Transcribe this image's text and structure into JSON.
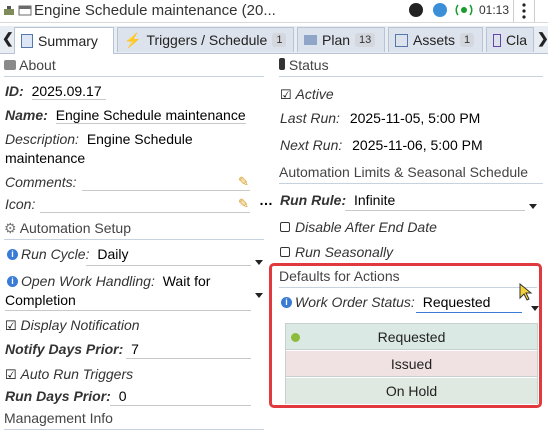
{
  "window": {
    "title": "Engine Schedule maintenance (20...",
    "clock": "01:13"
  },
  "tabs": [
    {
      "label": "Summary"
    },
    {
      "label": "Triggers / Schedule",
      "count": "1"
    },
    {
      "label": "Plan",
      "count": "13"
    },
    {
      "label": "Assets",
      "count": "1"
    },
    {
      "label": "Cla"
    }
  ],
  "about": {
    "heading": "About",
    "id_label": "ID:",
    "id_value": "2025.09.17",
    "name_label": "Name:",
    "name_value": "Engine Schedule maintenance",
    "desc_label": "Description:",
    "desc_value_1": "Engine Schedule",
    "desc_value_2": "maintenance",
    "comments_label": "Comments:",
    "icon_label": "Icon:"
  },
  "setup": {
    "heading": "Automation Setup",
    "run_cycle_label": "Run Cycle:",
    "run_cycle_value": "Daily",
    "open_work_label": "Open Work Handling:",
    "open_work_value_1": "Wait for",
    "open_work_value_2": "Completion",
    "display_notification": "Display Notification",
    "notify_days_label": "Notify Days Prior:",
    "notify_days_value": "7",
    "auto_run": "Auto Run Triggers",
    "run_days_label": "Run Days Prior:",
    "run_days_value": "0"
  },
  "management": {
    "heading": "Management Info"
  },
  "status": {
    "heading": "Status",
    "active": "Active",
    "last_run_label": "Last Run:",
    "last_run_value": "2025-11-05, 5:00 PM",
    "next_run_label": "Next Run:",
    "next_run_value": "2025-11-06, 5:00 PM"
  },
  "limits": {
    "heading": "Automation Limits & Seasonal Schedule",
    "run_rule_label": "Run Rule:",
    "run_rule_value": "Infinite",
    "disable_after": "Disable After End Date",
    "run_seasonally": "Run Seasonally"
  },
  "defaults": {
    "heading": "Defaults for Actions",
    "wo_status_label": "Work Order Status:",
    "wo_status_value": "Requested",
    "options": [
      "Requested",
      "Issued",
      "On Hold"
    ]
  },
  "colors": {
    "highlight": "#e0393e",
    "opt_requested": "#dbe9e4",
    "opt_issued": "#f0e2e2",
    "opt_onhold": "#dfe8e1"
  }
}
